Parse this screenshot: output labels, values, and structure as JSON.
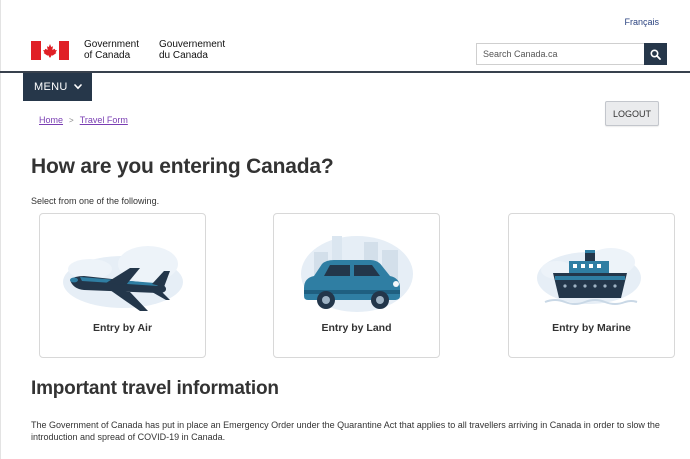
{
  "header": {
    "language_link": "Français",
    "gov_en_line1": "Government",
    "gov_en_line2": "of Canada",
    "gov_fr_line1": "Gouvernement",
    "gov_fr_line2": "du Canada",
    "search_placeholder": "Search Canada.ca",
    "search_icon": "search-icon",
    "flag_color": "#e01f26"
  },
  "nav": {
    "menu_label": "MENU",
    "menu_icon": "chevron-down-icon",
    "breadcrumb": [
      {
        "label": "Home"
      },
      {
        "label": "Travel Form"
      }
    ],
    "breadcrumb_separator": ">",
    "logout_label": "LOGOUT"
  },
  "main": {
    "title": "How are you entering Canada?",
    "instruction": "Select from one of the following.",
    "options": [
      {
        "label": "Entry by Air",
        "icon": "airplane-icon"
      },
      {
        "label": "Entry by Land",
        "icon": "car-icon"
      },
      {
        "label": "Entry by Marine",
        "icon": "ship-icon"
      }
    ],
    "info_title": "Important travel information",
    "info_text": "The Government of Canada has put in place an Emergency Order under the Quarantine Act that applies to all travellers arriving in Canada in order to slow the introduction and spread of COVID-19 in Canada."
  },
  "colors": {
    "header_dark": "#26374a",
    "link": "#7a3eb3",
    "illustration_blue": "#2f7ea3",
    "illustration_navy": "#23364a"
  }
}
